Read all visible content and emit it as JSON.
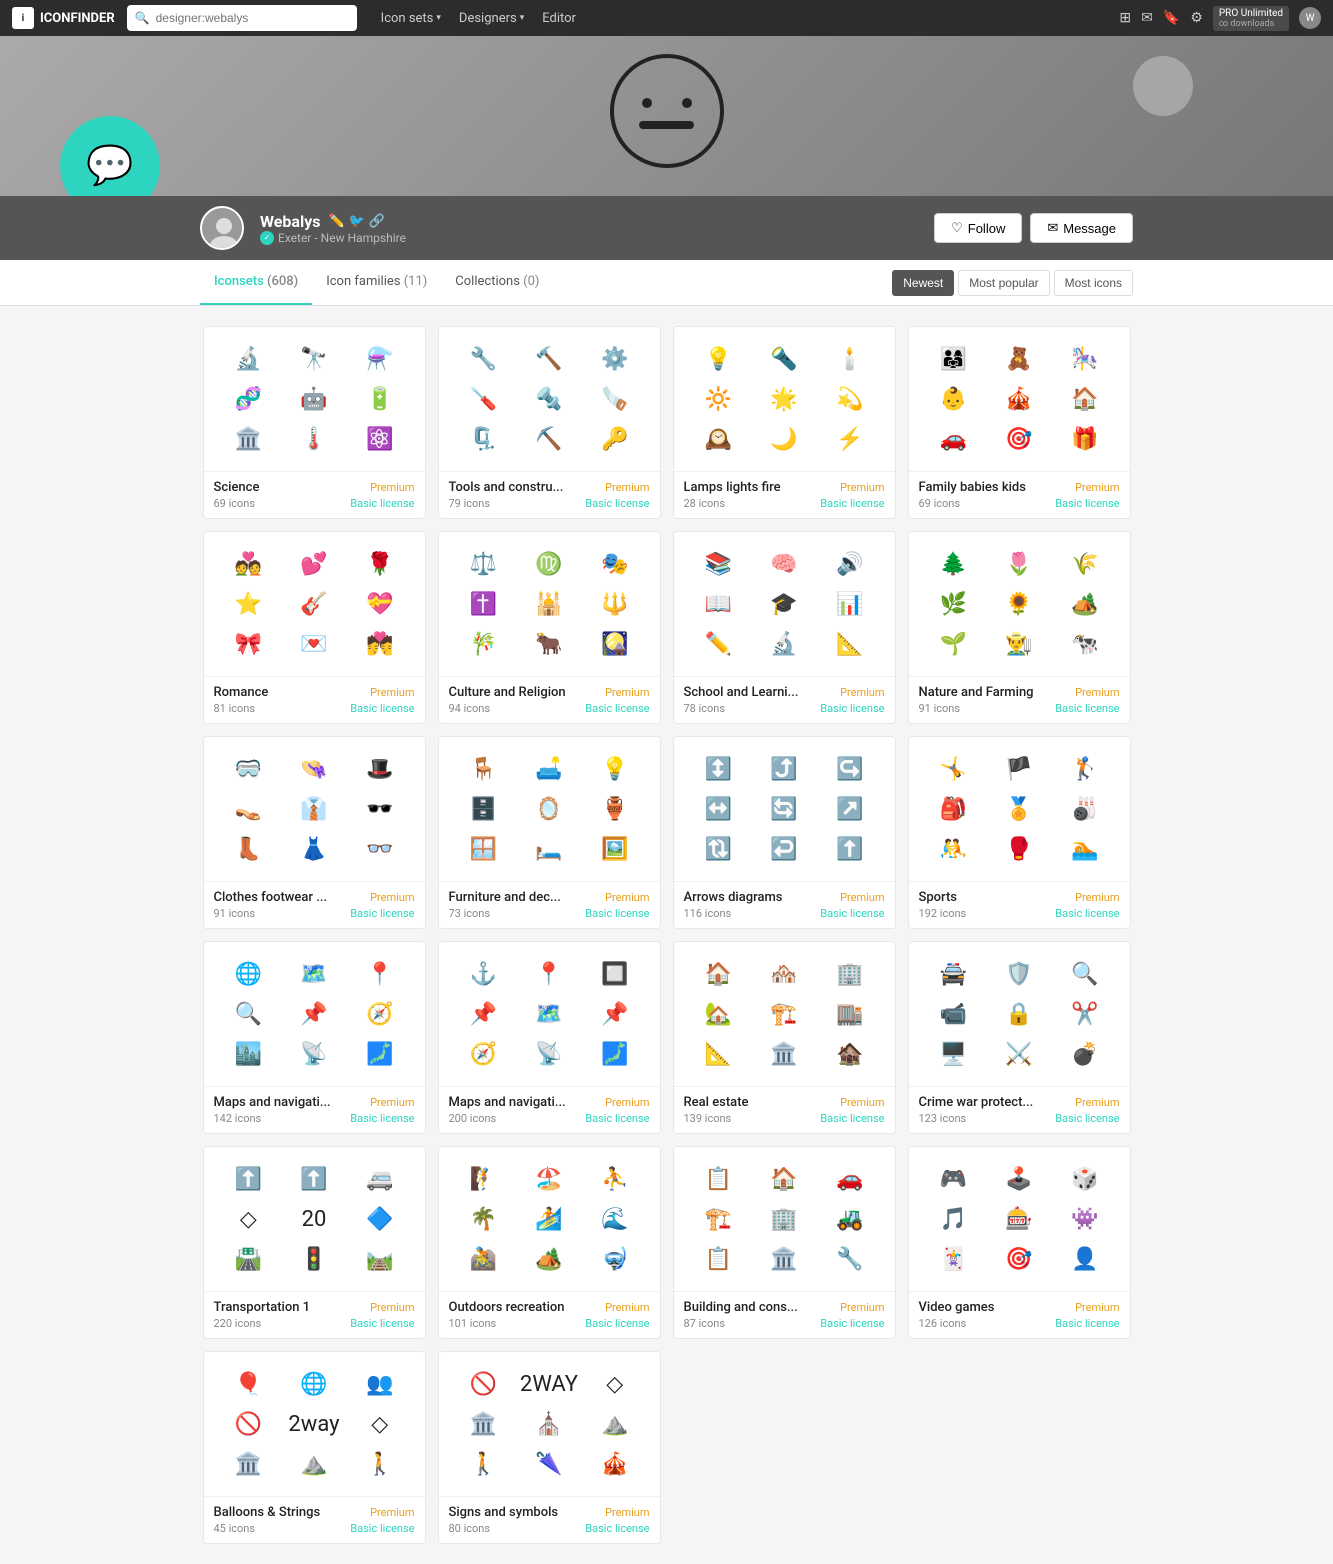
{
  "nav": {
    "logo": "ICONFINDER",
    "search_placeholder": "designer:webalys",
    "links": [
      {
        "label": "Icon sets",
        "has_dropdown": true
      },
      {
        "label": "Designers",
        "has_dropdown": true
      },
      {
        "label": "Editor",
        "has_dropdown": false
      }
    ],
    "pro_label": "PRO Unlimited",
    "pro_sub": "∞ downloads"
  },
  "profile": {
    "name": "Webalys",
    "location": "Exeter - New Hampshire",
    "verified": true,
    "follow_label": "Follow",
    "message_label": "Message"
  },
  "tabs": {
    "items": [
      {
        "label": "Iconsets",
        "count": "(608)",
        "active": true
      },
      {
        "label": "Icon families",
        "count": "(11)",
        "active": false
      },
      {
        "label": "Collections",
        "count": "(0)",
        "active": false
      }
    ],
    "sort_options": [
      {
        "label": "Newest",
        "active": true
      },
      {
        "label": "Most popular",
        "active": false
      },
      {
        "label": "Most icons",
        "active": false
      }
    ]
  },
  "icon_sets": [
    {
      "title": "Science",
      "icon_count": "69 icons",
      "badge": "Premium",
      "license": "Basic license",
      "icons": [
        "🔬",
        "🔭",
        "⚗️",
        "🧬",
        "🤖",
        "🔋",
        "🏛️",
        "🌡️",
        "⚛️"
      ]
    },
    {
      "title": "Tools and constru...",
      "icon_count": "79 icons",
      "badge": "Premium",
      "license": "Basic license",
      "icons": [
        "🔧",
        "🔨",
        "⚙️",
        "🪛",
        "🔩",
        "🪚",
        "🗜️",
        "⛏️",
        "🔑"
      ]
    },
    {
      "title": "Lamps lights fire",
      "icon_count": "28 icons",
      "badge": "Premium",
      "license": "Basic license",
      "icons": [
        "💡",
        "🔦",
        "🕯️",
        "🔆",
        "🌟",
        "💫",
        "🕰️",
        "🌙",
        "⚡"
      ]
    },
    {
      "title": "Family babies kids",
      "icon_count": "69 icons",
      "badge": "Premium",
      "license": "Basic license",
      "icons": [
        "👨‍👩‍👧",
        "🧸",
        "🎠",
        "👶",
        "🎪",
        "🏠",
        "🚗",
        "🎯",
        "🎁"
      ]
    },
    {
      "title": "Romance",
      "icon_count": "81 icons",
      "badge": "Premium",
      "license": "Basic license",
      "icons": [
        "💑",
        "💕",
        "🌹",
        "⭐",
        "🎸",
        "💝",
        "🎀",
        "💌",
        "💏"
      ]
    },
    {
      "title": "Culture and Religion",
      "icon_count": "94 icons",
      "badge": "Premium",
      "license": "Basic license",
      "icons": [
        "⚖️",
        "♍",
        "🎭",
        "✝️",
        "🕌",
        "🔱",
        "🎋",
        "🐂",
        "🎑"
      ]
    },
    {
      "title": "School and Learni...",
      "icon_count": "78 icons",
      "badge": "Premium",
      "license": "Basic license",
      "icons": [
        "📚",
        "🧠",
        "🔊",
        "📖",
        "🎓",
        "📊",
        "✏️",
        "🔬",
        "📐"
      ]
    },
    {
      "title": "Nature and Farming",
      "icon_count": "91 icons",
      "badge": "Premium",
      "license": "Basic license",
      "icons": [
        "🌲",
        "🌷",
        "🌾",
        "🌿",
        "🌻",
        "🏕️",
        "🌱",
        "👨‍🌾",
        "🐄"
      ]
    },
    {
      "title": "Clothes footwear ...",
      "icon_count": "91 icons",
      "badge": "Premium",
      "license": "Basic license",
      "icons": [
        "🥽",
        "👒",
        "🎩",
        "👡",
        "👔",
        "🕶️",
        "👢",
        "👗",
        "👓"
      ]
    },
    {
      "title": "Furniture and dec...",
      "icon_count": "73 icons",
      "badge": "Premium",
      "license": "Basic license",
      "icons": [
        "🪑",
        "🛋️",
        "💡",
        "🗄️",
        "🪞",
        "🏺",
        "🪟",
        "🛏️",
        "🖼️"
      ]
    },
    {
      "title": "Arrows diagrams",
      "icon_count": "116 icons",
      "badge": "Premium",
      "license": "Basic license",
      "icons": [
        "↕️",
        "⤴️",
        "↪️",
        "↔️",
        "🔄",
        "↗️",
        "🔃",
        "↩️",
        "⬆️"
      ]
    },
    {
      "title": "Sports",
      "icon_count": "192 icons",
      "badge": "Premium",
      "license": "Basic license",
      "icons": [
        "🤸",
        "🏴",
        "🏌️",
        "🎒",
        "🏅",
        "🎳",
        "🤼",
        "🥊",
        "🏊"
      ]
    },
    {
      "title": "Maps and navigati...",
      "icon_count": "142 icons",
      "badge": "Premium",
      "license": "Basic license",
      "icons": [
        "🌐",
        "🗺️",
        "📍",
        "🔍",
        "📌",
        "🧭",
        "🏙️",
        "📡",
        "🗾"
      ]
    },
    {
      "title": "Maps and navigati...",
      "icon_count": "200 icons",
      "badge": "Premium",
      "license": "Basic license",
      "icons": [
        "⚓",
        "📍",
        "🔲",
        "📌",
        "🗺️",
        "📌",
        "🧭",
        "📡",
        "🗾"
      ]
    },
    {
      "title": "Real estate",
      "icon_count": "139 icons",
      "badge": "Premium",
      "license": "Basic license",
      "icons": [
        "🏠",
        "🏘️",
        "🏢",
        "🏡",
        "🏗️",
        "🏬",
        "📐",
        "🏛️",
        "🏚️"
      ]
    },
    {
      "title": "Crime war protect...",
      "icon_count": "123 icons",
      "badge": "Premium",
      "license": "Basic license",
      "icons": [
        "🚔",
        "🛡️",
        "🔍",
        "📹",
        "🔒",
        "✂️",
        "🖥️",
        "⚔️",
        "💣"
      ]
    },
    {
      "title": "Transportation 1",
      "icon_count": "220 icons",
      "badge": "Premium",
      "license": "Basic license",
      "icons": [
        "⬆️",
        "⬆️",
        "🚐",
        "◇",
        "20",
        "🔷",
        "🛣️",
        "🚦",
        "🛤️"
      ]
    },
    {
      "title": "Outdoors recreation",
      "icon_count": "101 icons",
      "badge": "Premium",
      "license": "Basic license",
      "icons": [
        "🧗",
        "🏖️",
        "⛹️",
        "🌴",
        "🏄",
        "🌊",
        "🚵",
        "🏕️",
        "🤿"
      ]
    },
    {
      "title": "Building and cons...",
      "icon_count": "87 icons",
      "badge": "Premium",
      "license": "Basic license",
      "icons": [
        "📋",
        "🏠",
        "🚗",
        "🏗️",
        "🏢",
        "🚜",
        "📋",
        "🏛️",
        "🔧"
      ]
    },
    {
      "title": "Video games",
      "icon_count": "126 icons",
      "badge": "Premium",
      "license": "Basic license",
      "icons": [
        "🎮",
        "🕹️",
        "🎲",
        "🎵",
        "🎰",
        "👾",
        "🃏",
        "🎯",
        "👤"
      ]
    },
    {
      "title": "Balloons & Strings",
      "icon_count": "45 icons",
      "badge": "Premium",
      "license": "Basic license",
      "icons": [
        "🎈",
        "🌐",
        "👥",
        "🚫",
        "2way",
        "◇",
        "🏛️",
        "⛰️",
        "🚶"
      ]
    },
    {
      "title": "Signs and symbols",
      "icon_count": "80 icons",
      "badge": "Premium",
      "license": "Basic license",
      "icons": [
        "🚫",
        "2WAY",
        "◇",
        "🏛️",
        "⛪",
        "⛰️",
        "🚶",
        "🌂",
        "🎪"
      ]
    }
  ]
}
